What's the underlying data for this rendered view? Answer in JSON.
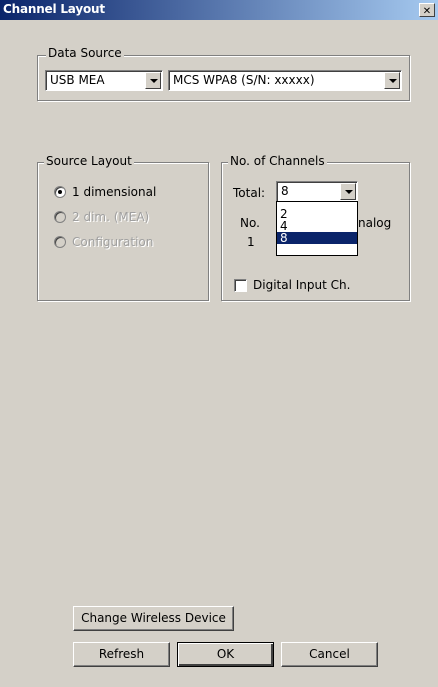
{
  "window": {
    "title": "Channel Layout",
    "close_glyph": "✕"
  },
  "data_source": {
    "label": "Data Source",
    "device_select": "USB MEA",
    "model_select": "MCS WPA8 (S/N: xxxxx)"
  },
  "source_layout": {
    "label": "Source Layout",
    "options": [
      {
        "label": "1 dimensional",
        "selected": true,
        "enabled": true
      },
      {
        "label": "2 dim. (MEA)",
        "selected": false,
        "enabled": false
      },
      {
        "label": "Configuration",
        "selected": false,
        "enabled": false
      }
    ]
  },
  "channels": {
    "label": "No. of Channels",
    "total_label": "Total:",
    "total_value": "8",
    "no_label": "No.",
    "no_value": "1",
    "analog_partial": "nalog",
    "dropdown_options": [
      "2",
      "4",
      "8"
    ],
    "dropdown_selected": "8",
    "digital_input_label": "Digital Input Ch.",
    "digital_input_checked": false
  },
  "buttons": {
    "change_wireless": "Change Wireless Device",
    "refresh": "Refresh",
    "ok": "OK",
    "cancel": "Cancel"
  },
  "colors": {
    "titlebar_start": "#0a246a",
    "titlebar_end": "#a6caf0",
    "dialog_bg": "#d4d0c8",
    "selection": "#0a246a"
  }
}
